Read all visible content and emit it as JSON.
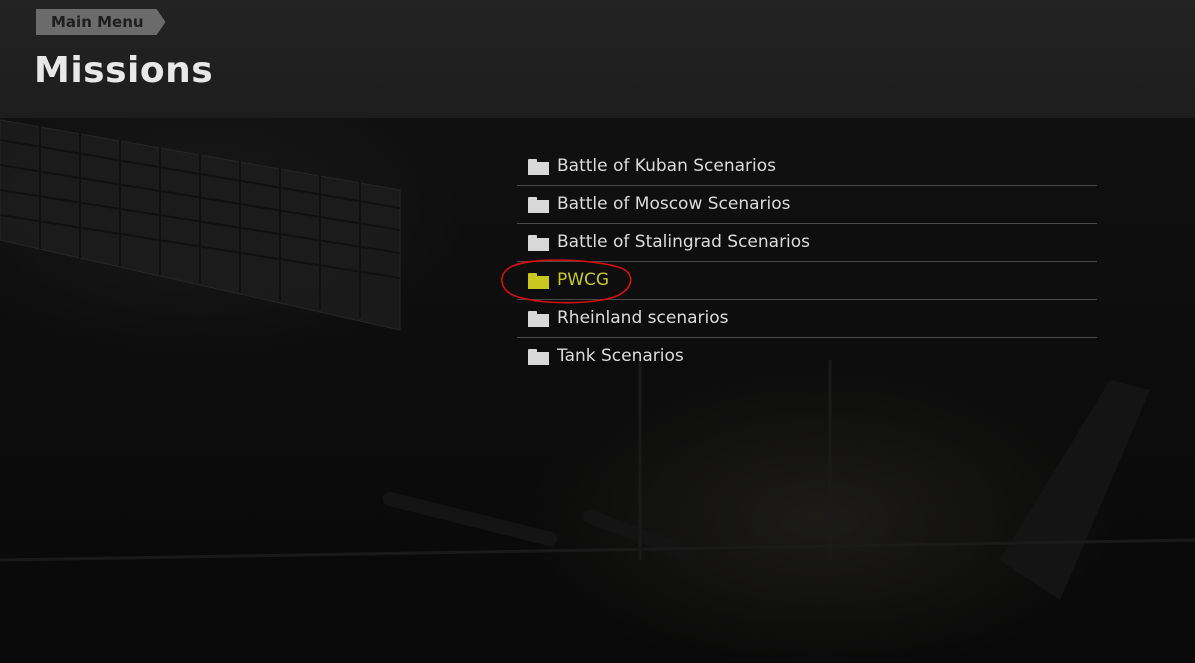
{
  "header": {
    "breadcrumb_label": "Main Menu",
    "title": "Missions"
  },
  "missions": {
    "items": [
      {
        "label": "Battle of Kuban Scenarios",
        "icon": "folder-icon",
        "selected": false
      },
      {
        "label": "Battle of Moscow Scenarios",
        "icon": "folder-icon",
        "selected": false
      },
      {
        "label": "Battle of Stalingrad Scenarios",
        "icon": "folder-icon",
        "selected": false
      },
      {
        "label": "PWCG",
        "icon": "folder-icon",
        "selected": true
      },
      {
        "label": "Rheinland scenarios",
        "icon": "folder-icon",
        "selected": false
      },
      {
        "label": "Tank Scenarios",
        "icon": "folder-icon",
        "selected": false
      }
    ]
  },
  "colors": {
    "highlight": "#c8c820",
    "annotation": "#d41010",
    "text": "#dcdcdc"
  }
}
